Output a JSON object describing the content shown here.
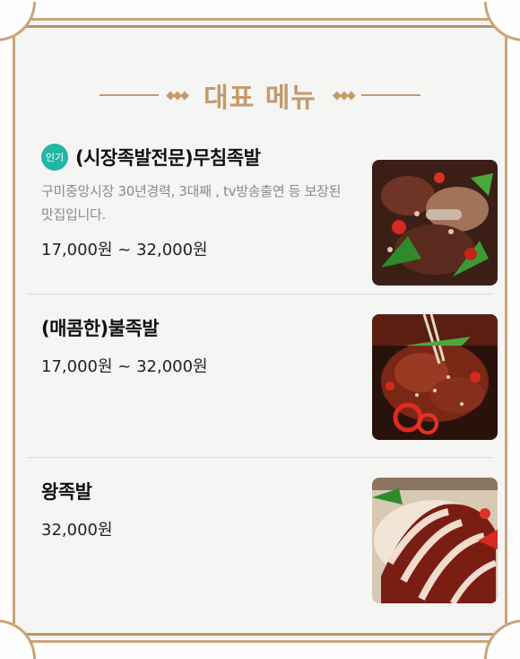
{
  "section_title": "대표 메뉴",
  "menu": [
    {
      "badge": "인기",
      "name": "(시장족발전문)무침족발",
      "description": "구미중앙시장 30년경력, 3대째 , tv방송출연 등 보장된 맛집입니다.",
      "price": "17,000원 ~ 32,000원",
      "image": "spicy-seasoned-jokbal-photo"
    },
    {
      "name": "(매콤한)불족발",
      "price": "17,000원 ~ 32,000원",
      "image": "fire-jokbal-photo"
    },
    {
      "name": "왕족발",
      "price": "32,000원",
      "image": "sliced-pork-trotters-photo"
    }
  ],
  "colors": {
    "accent_gold": "#c49a6c",
    "badge_teal": "#23b5a5",
    "background": "#f5f5f4"
  }
}
